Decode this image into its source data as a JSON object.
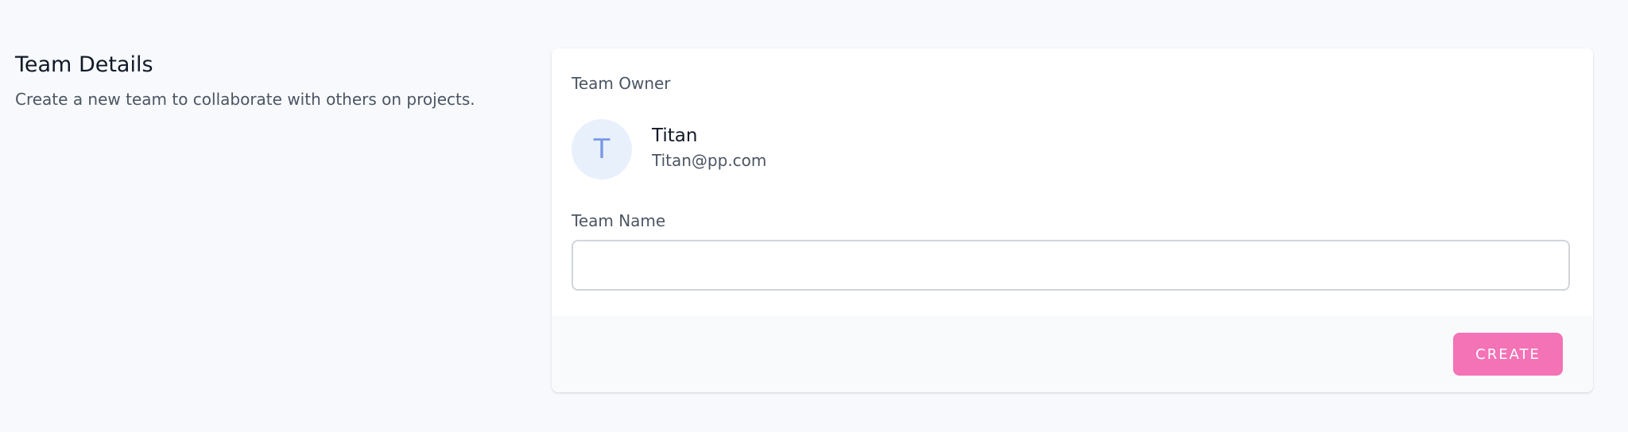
{
  "section": {
    "title": "Team Details",
    "description": "Create a new team to collaborate with others on projects."
  },
  "owner": {
    "label": "Team Owner",
    "avatar_initial": "T",
    "name": "Titan",
    "email": "Titan@pp.com"
  },
  "team_name": {
    "label": "Team Name",
    "value": "",
    "placeholder": ""
  },
  "actions": {
    "create_label": "CREATE"
  },
  "colors": {
    "page_background": "#f7f9fc",
    "card_background": "#ffffff",
    "footer_background": "#f9fafb",
    "avatar_background": "#e8f0fb",
    "avatar_text": "#7b98e6",
    "accent_button": "#f472b6"
  }
}
